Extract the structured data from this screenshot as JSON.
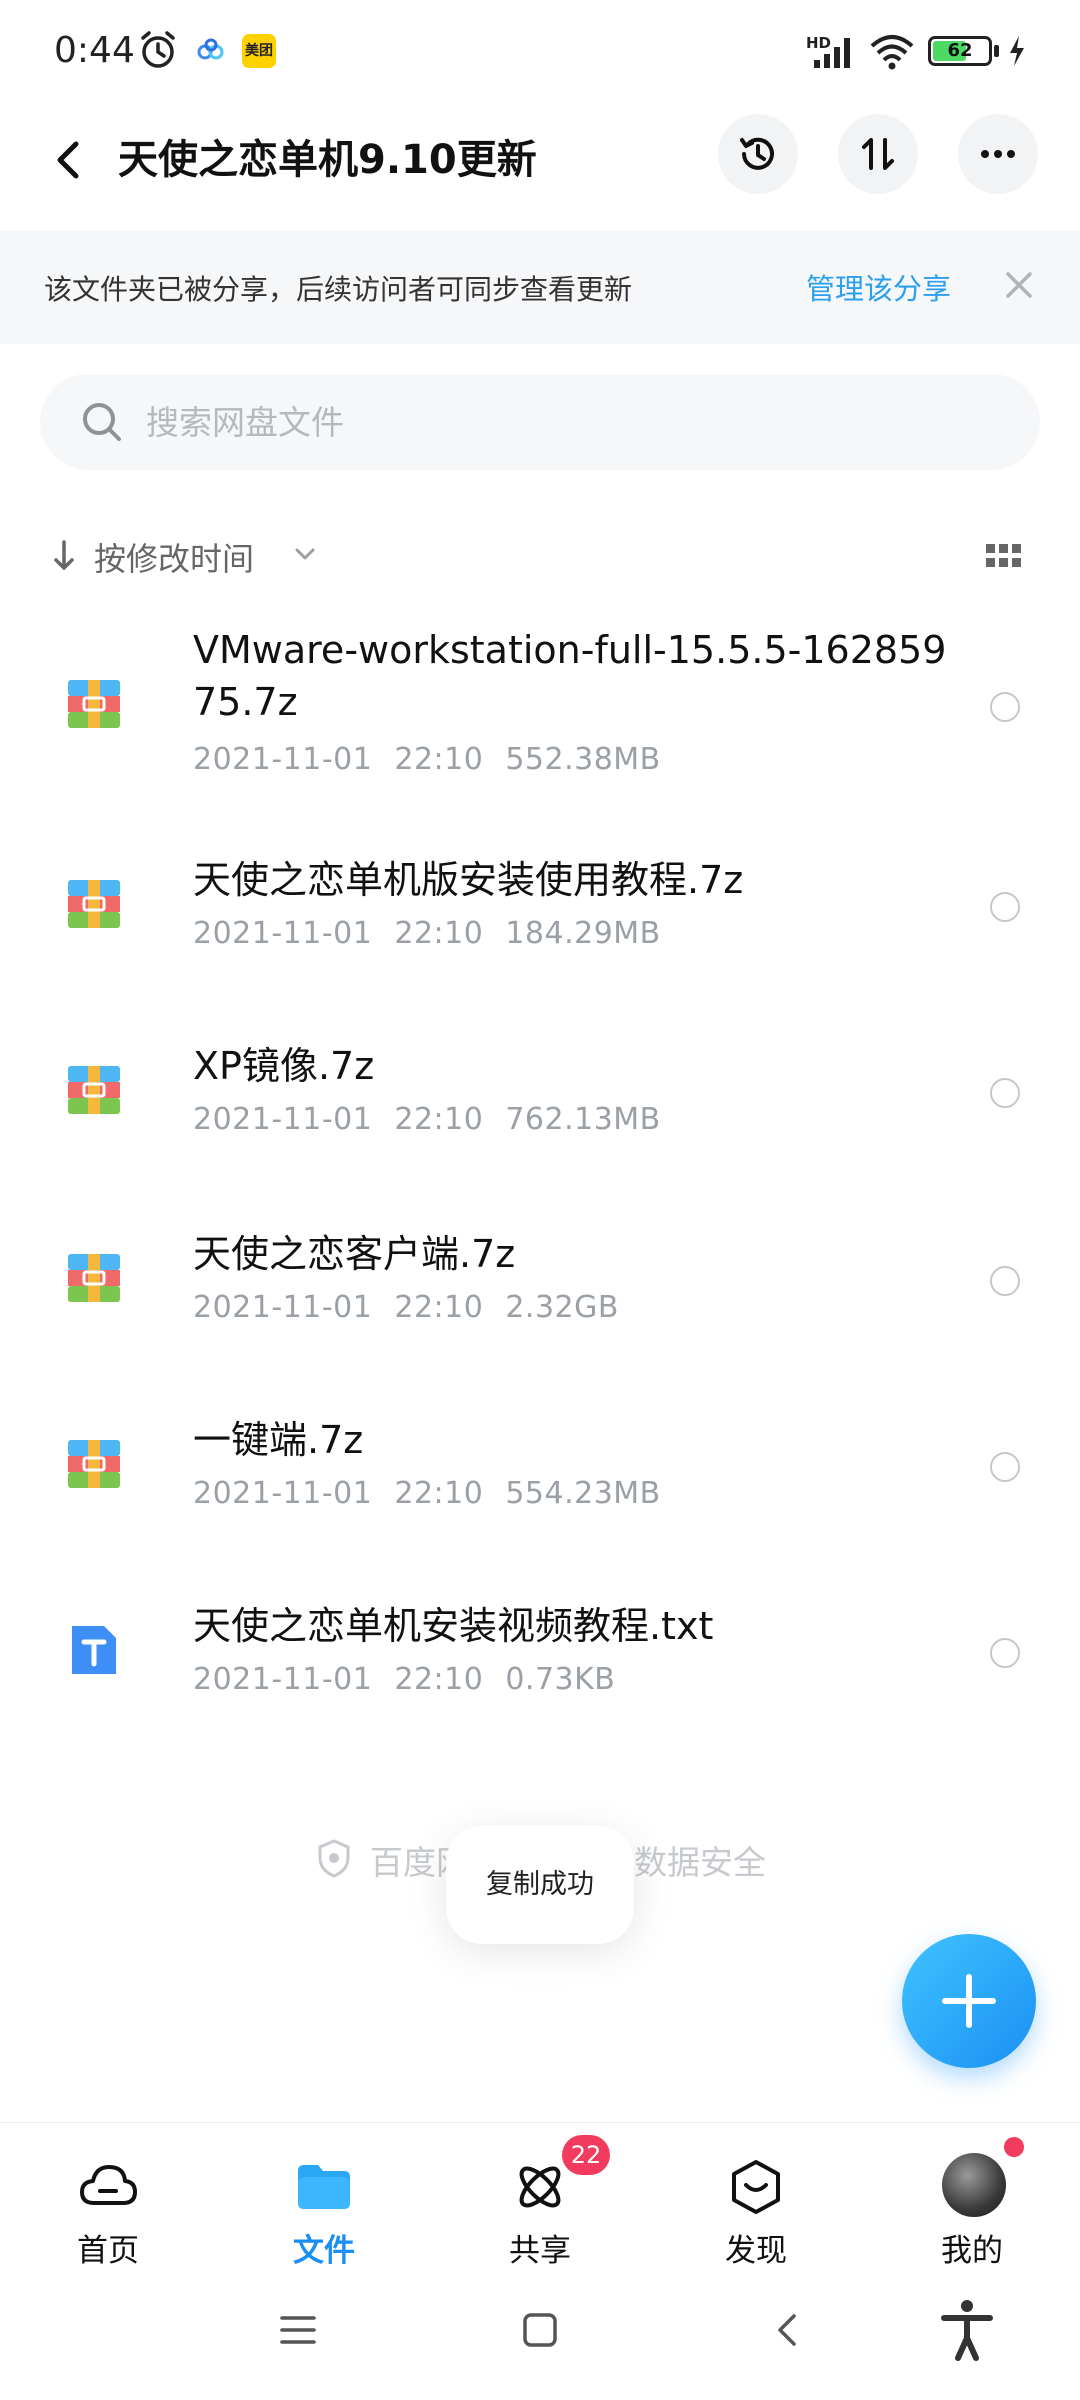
{
  "status_bar": {
    "time": "0:44",
    "meituan_label": "美团",
    "network_label": "HD",
    "battery_level": "62",
    "battery_fraction": 0.62,
    "icons": [
      "alarm-icon",
      "baidu-netdisk-icon",
      "meituan-icon",
      "signal-icon",
      "wifi-icon",
      "battery-icon",
      "charging-icon"
    ]
  },
  "header": {
    "title": "天使之恋单机9.10更新",
    "icons": [
      "back-icon",
      "history-icon",
      "transfer-icon",
      "more-icon"
    ]
  },
  "share_banner": {
    "text": "该文件夹已被分享，后续访问者可同步查看更新",
    "link": "管理该分享"
  },
  "search": {
    "placeholder": "搜索网盘文件",
    "value": ""
  },
  "sort": {
    "label": "按修改时间"
  },
  "files": [
    {
      "name": "VMware-workstation-full-15.5.5-16285975.7z",
      "date": "2021-11-01",
      "time": "22:10",
      "size": "552.38MB",
      "type": "archive"
    },
    {
      "name": "天使之恋单机版安装使用教程.7z",
      "date": "2021-11-01",
      "time": "22:10",
      "size": "184.29MB",
      "type": "archive"
    },
    {
      "name": "XP镜像.7z",
      "date": "2021-11-01",
      "time": "22:10",
      "size": "762.13MB",
      "type": "archive"
    },
    {
      "name": "天使之恋客户端.7z",
      "date": "2021-11-01",
      "time": "22:10",
      "size": "2.32GB",
      "type": "archive"
    },
    {
      "name": "一键端.7z",
      "date": "2021-11-01",
      "time": "22:10",
      "size": "554.23MB",
      "type": "archive"
    },
    {
      "name": "天使之恋单机安装视频教程.txt",
      "date": "2021-11-01",
      "time": "22:10",
      "size": "0.73KB",
      "type": "text"
    }
  ],
  "footer_note": "百度网盘保护你的数据安全",
  "toast": "复制成功",
  "bottom_nav": {
    "items": [
      {
        "label": "首页",
        "icon": "cloud-icon",
        "active": false
      },
      {
        "label": "文件",
        "icon": "folder-icon",
        "active": true
      },
      {
        "label": "共享",
        "icon": "share-atom-icon",
        "active": false,
        "badge": "22"
      },
      {
        "label": "发现",
        "icon": "discover-icon",
        "active": false
      },
      {
        "label": "我的",
        "icon": "avatar",
        "active": false
      }
    ]
  },
  "colors": {
    "accent": "#1a8ff3",
    "link": "#2b9ff0",
    "badge": "#f23b5f",
    "banner_bg": "#f6f7f9"
  }
}
